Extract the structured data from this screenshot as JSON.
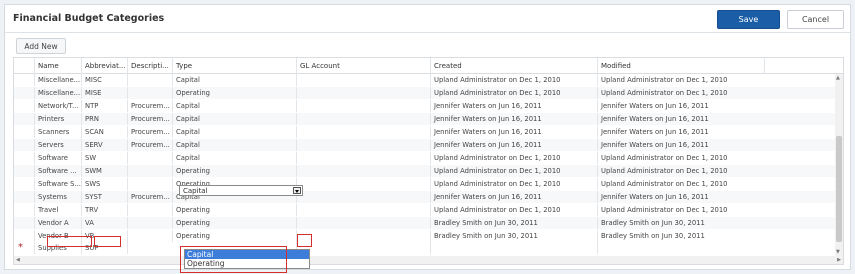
{
  "header": {
    "title": "Financial Budget Categories",
    "save_label": "Save",
    "cancel_label": "Cancel"
  },
  "toolbar": {
    "add_new_label": "Add New"
  },
  "columns": [
    "Name",
    "Abbreviat...",
    "Descripti...",
    "Type",
    "GL Account",
    "Created",
    "Modified"
  ],
  "rows": [
    {
      "name": "Miscellane...",
      "abbr": "MISC",
      "desc": "",
      "type": "Capital",
      "gl": "",
      "created": "Upland Administrator on Dec 1, 2010",
      "modified": "Upland Administrator on Dec 1, 2010"
    },
    {
      "name": "Miscellane...",
      "abbr": "MISE",
      "desc": "",
      "type": "Operating",
      "gl": "",
      "created": "Upland Administrator on Dec 1, 2010",
      "modified": "Upland Administrator on Dec 1, 2010"
    },
    {
      "name": "Network/T...",
      "abbr": "NTP",
      "desc": "Procurem...",
      "type": "Capital",
      "gl": "",
      "created": "Jennifer Waters on Jun 16, 2011",
      "modified": "Jennifer Waters on Jun 16, 2011"
    },
    {
      "name": "Printers",
      "abbr": "PRN",
      "desc": "Procurem...",
      "type": "Capital",
      "gl": "",
      "created": "Jennifer Waters on Jun 16, 2011",
      "modified": "Jennifer Waters on Jun 16, 2011"
    },
    {
      "name": "Scanners",
      "abbr": "SCAN",
      "desc": "Procurem...",
      "type": "Capital",
      "gl": "",
      "created": "Jennifer Waters on Jun 16, 2011",
      "modified": "Jennifer Waters on Jun 16, 2011"
    },
    {
      "name": "Servers",
      "abbr": "SERV",
      "desc": "Procurem...",
      "type": "Capital",
      "gl": "",
      "created": "Jennifer Waters on Jun 16, 2011",
      "modified": "Jennifer Waters on Jun 16, 2011"
    },
    {
      "name": "Software",
      "abbr": "SW",
      "desc": "",
      "type": "Capital",
      "gl": "",
      "created": "Upland Administrator on Dec 1, 2010",
      "modified": "Upland Administrator on Dec 1, 2010"
    },
    {
      "name": "Software ...",
      "abbr": "SWM",
      "desc": "",
      "type": "Operating",
      "gl": "",
      "created": "Upland Administrator on Dec 1, 2010",
      "modified": "Upland Administrator on Dec 1, 2010"
    },
    {
      "name": "Software S...",
      "abbr": "SWS",
      "desc": "",
      "type": "Operating",
      "gl": "",
      "created": "Upland Administrator on Dec 1, 2010",
      "modified": "Upland Administrator on Dec 1, 2010"
    },
    {
      "name": "Systems",
      "abbr": "SYST",
      "desc": "Procurem...",
      "type": "Capital",
      "gl": "",
      "created": "Jennifer Waters on Jun 16, 2011",
      "modified": "Jennifer Waters on Jun 16, 2011"
    },
    {
      "name": "Travel",
      "abbr": "TRV",
      "desc": "",
      "type": "Operating",
      "gl": "",
      "created": "Upland Administrator on Dec 1, 2010",
      "modified": "Upland Administrator on Dec 1, 2010"
    },
    {
      "name": "Vendor A",
      "abbr": "VA",
      "desc": "",
      "type": "Operating",
      "gl": "",
      "created": "Bradley Smith on Jun 30, 2011",
      "modified": "Bradley Smith on Jun 30, 2011"
    },
    {
      "name": "Vendor B",
      "abbr": "VB",
      "desc": "",
      "type": "Operating",
      "gl": "",
      "created": "Bradley Smith on Jun 30, 2011",
      "modified": "Bradley Smith on Jun 30, 2011"
    }
  ],
  "new_row": {
    "marker": "*",
    "name": "Supplies",
    "abbr": "SUP",
    "type_value": "Capital"
  },
  "type_options": [
    "Capital",
    "Operating"
  ],
  "colors": {
    "accent": "#1b5ea7",
    "highlight": "#d32f2f",
    "selected_option": "#3b7dd8"
  }
}
